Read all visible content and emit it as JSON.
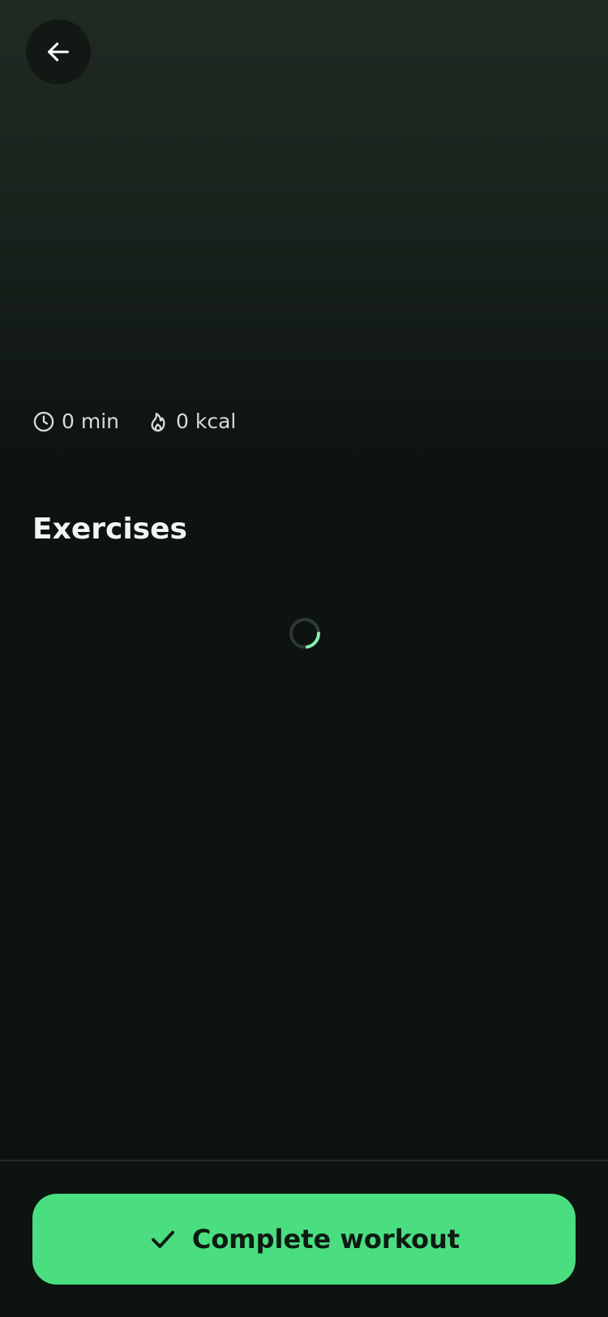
{
  "header": {
    "back_icon": "arrow-left-icon"
  },
  "stats": {
    "duration": {
      "icon": "clock-icon",
      "text": "0 min"
    },
    "calories": {
      "icon": "flame-icon",
      "text": "0 kcal"
    }
  },
  "exercises": {
    "title": "Exercises",
    "loading_icon": "spinner-icon"
  },
  "footer": {
    "complete_button": {
      "icon": "check-icon",
      "label": "Complete workout"
    }
  },
  "colors": {
    "accent": "#4ade80",
    "background": "#0d1310",
    "hero_gradient_top": "#1f2a23"
  }
}
